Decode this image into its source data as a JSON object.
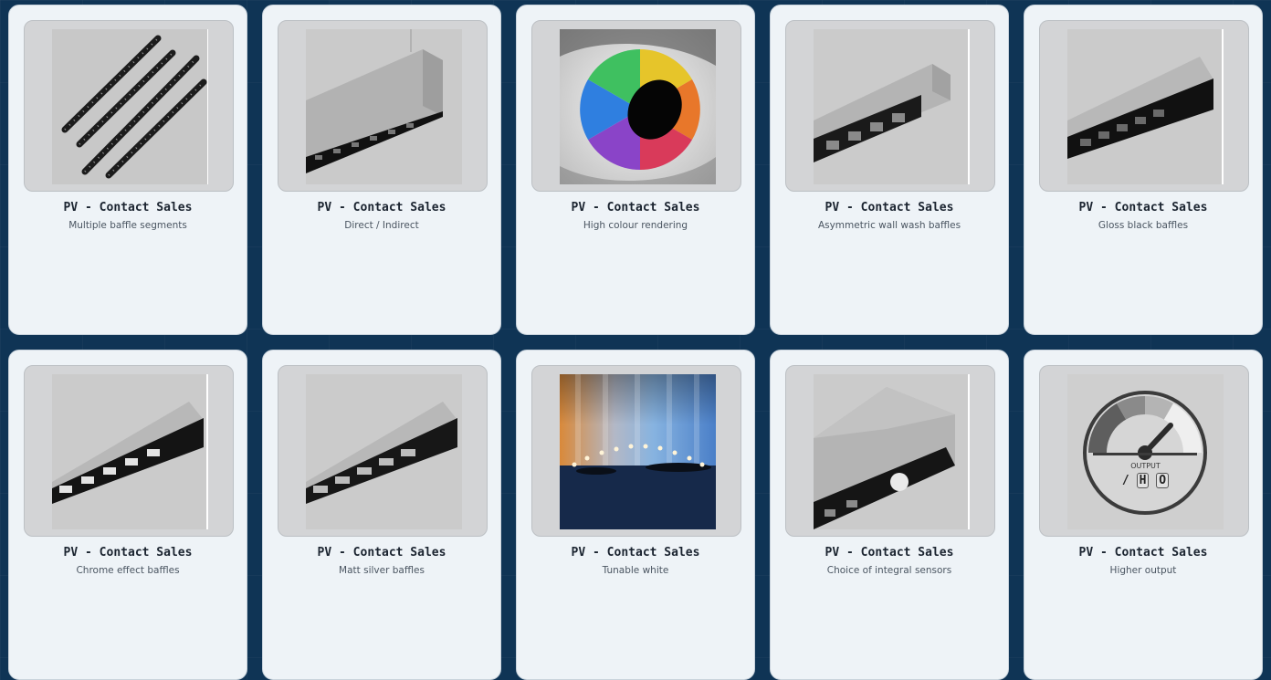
{
  "products": [
    {
      "title": "PV - Contact Sales",
      "subtitle": "Multiple baffle segments",
      "icon": "linear-segments-image"
    },
    {
      "title": "PV - Contact Sales",
      "subtitle": "Direct / Indirect",
      "icon": "pendant-linear-image"
    },
    {
      "title": "PV - Contact Sales",
      "subtitle": "High colour rendering",
      "icon": "rainbow-eye-image"
    },
    {
      "title": "PV - Contact Sales",
      "subtitle": "Asymmetric wall wash baffles",
      "icon": "wall-wash-linear-image"
    },
    {
      "title": "PV - Contact Sales",
      "subtitle": "Gloss black baffles",
      "icon": "gloss-black-linear-image"
    },
    {
      "title": "PV - Contact Sales",
      "subtitle": "Chrome effect baffles",
      "icon": "chrome-linear-image"
    },
    {
      "title": "PV - Contact Sales",
      "subtitle": "Matt silver baffles",
      "icon": "matt-silver-linear-image"
    },
    {
      "title": "PV - Contact Sales",
      "subtitle": "Tunable white",
      "icon": "tunable-white-image"
    },
    {
      "title": "PV - Contact Sales",
      "subtitle": "Choice of integral sensors",
      "icon": "sensor-linear-image"
    },
    {
      "title": "PV - Contact Sales",
      "subtitle": "Higher output",
      "icon": "output-gauge-image"
    }
  ],
  "gauge": {
    "label": "OUTPUT",
    "prefix": "/",
    "letters": [
      "H",
      "O"
    ]
  },
  "colors": {
    "background": "#0f3455",
    "card": "#eef3f7",
    "thumb": "#d3d4d6"
  }
}
